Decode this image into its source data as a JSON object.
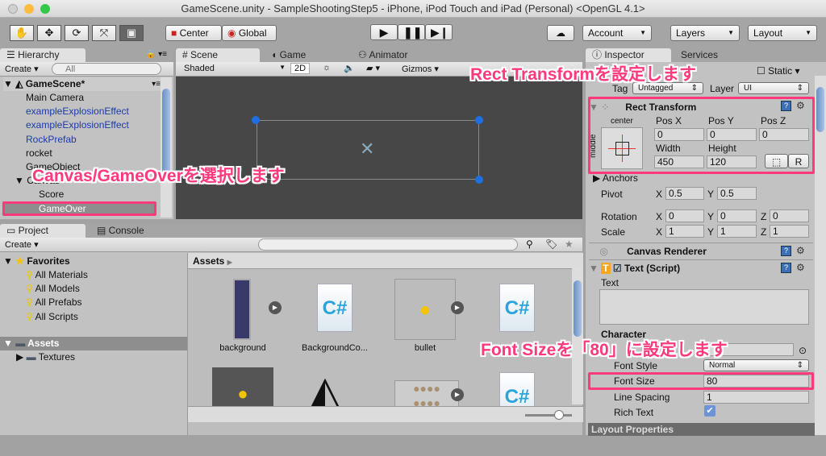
{
  "window": {
    "title": "GameScene.unity - SampleShootingStep5 - iPhone, iPod Touch and iPad (Personal) <OpenGL 4.1>"
  },
  "toolbar": {
    "tools": [
      "hand-icon",
      "move-icon",
      "rotate-icon",
      "scale-icon",
      "rect-icon"
    ],
    "center": "Center",
    "global": "Global",
    "account": "Account",
    "layers": "Layers",
    "layout": "Layout"
  },
  "hierarchy": {
    "tab": "Hierarchy",
    "create": "Create",
    "search_placeholder": "All",
    "scene": "GameScene*",
    "items": [
      {
        "label": "Main Camera",
        "prefab": false
      },
      {
        "label": "exampleExplosionEffect",
        "prefab": true
      },
      {
        "label": "exampleExplosionEffect",
        "prefab": true
      },
      {
        "label": "RockPrefab",
        "prefab": true
      },
      {
        "label": "rocket",
        "prefab": false
      },
      {
        "label": "GameObject",
        "prefab": false
      },
      {
        "label": "Canvas",
        "prefab": false
      },
      {
        "label": "Score",
        "prefab": false
      },
      {
        "label": "GameOver",
        "prefab": false,
        "selected": true
      }
    ]
  },
  "scene": {
    "tabs": [
      "Scene",
      "Game",
      "Animator"
    ],
    "shading": "Shaded",
    "mode2d": "2D",
    "gizmos": "Gizmos"
  },
  "project": {
    "tabs": [
      "Project",
      "Console"
    ],
    "create": "Create",
    "favorites": "Favorites",
    "favorite_items": [
      "All Materials",
      "All Models",
      "All Prefabs",
      "All Scripts"
    ],
    "assets_root": "Assets",
    "folders": [
      "Textures"
    ],
    "breadcrumb": "Assets",
    "assets": [
      {
        "name": "background",
        "type": "texture"
      },
      {
        "name": "BackgroundCo...",
        "type": "script"
      },
      {
        "name": "bullet",
        "type": "texture"
      },
      {
        "name": "",
        "type": "script"
      },
      {
        "name": "",
        "type": "texture"
      },
      {
        "name": "",
        "type": "scene"
      },
      {
        "name": "",
        "type": "texture"
      },
      {
        "name": "",
        "type": "script"
      }
    ]
  },
  "inspector": {
    "tabs": [
      "Inspector",
      "Services"
    ],
    "static": "Static",
    "tag_label": "Tag",
    "tag": "Untagged",
    "layer_label": "Layer",
    "layer": "UI",
    "rect_transform": {
      "title": "Rect Transform",
      "anchor_h": "center",
      "anchor_v": "middle",
      "pos_x_label": "Pos X",
      "pos_y_label": "Pos Y",
      "pos_z_label": "Pos Z",
      "pos_x": "0",
      "pos_y": "0",
      "pos_z": "0",
      "width_label": "Width",
      "height_label": "Height",
      "width": "450",
      "height": "120",
      "r_button": "R",
      "anchors": "Anchors",
      "pivot": "Pivot",
      "pivot_x": "0.5",
      "pivot_y": "0.5",
      "rotation": "Rotation",
      "rot_x": "0",
      "rot_y": "0",
      "rot_z": "0",
      "scale": "Scale",
      "scale_x": "1",
      "scale_y": "1",
      "scale_z": "1",
      "x": "X",
      "y": "Y",
      "z": "Z"
    },
    "canvas_renderer": "Canvas Renderer",
    "text_script": {
      "title": "Text (Script)",
      "text_label": "Text",
      "text_value": "",
      "character": "Character",
      "font_style_label": "Font Style",
      "font_style": "Normal",
      "font_size_label": "Font Size",
      "font_size": "80",
      "line_spacing_label": "Line Spacing",
      "line_spacing": "1",
      "rich_text_label": "Rich Text",
      "rich_text": true
    },
    "layout_properties": "Layout Properties"
  },
  "annotations": {
    "rect": "Rect Transformを設定します",
    "canvas": "Canvas/GameOverを選択します",
    "font": "Font Sizeを「80」に設定します"
  },
  "colors": {
    "annotation": "#ff3a7c",
    "prefab_text": "#1a3ca8",
    "scene_bg": "#474747"
  }
}
